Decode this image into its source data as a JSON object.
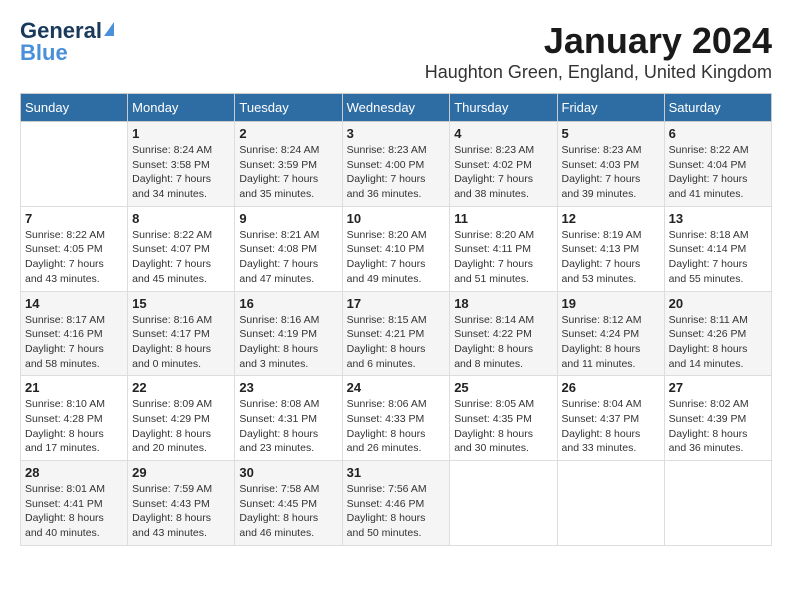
{
  "logo": {
    "general": "General",
    "blue": "Blue"
  },
  "title": "January 2024",
  "location": "Haughton Green, England, United Kingdom",
  "days_of_week": [
    "Sunday",
    "Monday",
    "Tuesday",
    "Wednesday",
    "Thursday",
    "Friday",
    "Saturday"
  ],
  "weeks": [
    [
      {
        "day": "",
        "info": ""
      },
      {
        "day": "1",
        "info": "Sunrise: 8:24 AM\nSunset: 3:58 PM\nDaylight: 7 hours\nand 34 minutes."
      },
      {
        "day": "2",
        "info": "Sunrise: 8:24 AM\nSunset: 3:59 PM\nDaylight: 7 hours\nand 35 minutes."
      },
      {
        "day": "3",
        "info": "Sunrise: 8:23 AM\nSunset: 4:00 PM\nDaylight: 7 hours\nand 36 minutes."
      },
      {
        "day": "4",
        "info": "Sunrise: 8:23 AM\nSunset: 4:02 PM\nDaylight: 7 hours\nand 38 minutes."
      },
      {
        "day": "5",
        "info": "Sunrise: 8:23 AM\nSunset: 4:03 PM\nDaylight: 7 hours\nand 39 minutes."
      },
      {
        "day": "6",
        "info": "Sunrise: 8:22 AM\nSunset: 4:04 PM\nDaylight: 7 hours\nand 41 minutes."
      }
    ],
    [
      {
        "day": "7",
        "info": "Sunrise: 8:22 AM\nSunset: 4:05 PM\nDaylight: 7 hours\nand 43 minutes."
      },
      {
        "day": "8",
        "info": "Sunrise: 8:22 AM\nSunset: 4:07 PM\nDaylight: 7 hours\nand 45 minutes."
      },
      {
        "day": "9",
        "info": "Sunrise: 8:21 AM\nSunset: 4:08 PM\nDaylight: 7 hours\nand 47 minutes."
      },
      {
        "day": "10",
        "info": "Sunrise: 8:20 AM\nSunset: 4:10 PM\nDaylight: 7 hours\nand 49 minutes."
      },
      {
        "day": "11",
        "info": "Sunrise: 8:20 AM\nSunset: 4:11 PM\nDaylight: 7 hours\nand 51 minutes."
      },
      {
        "day": "12",
        "info": "Sunrise: 8:19 AM\nSunset: 4:13 PM\nDaylight: 7 hours\nand 53 minutes."
      },
      {
        "day": "13",
        "info": "Sunrise: 8:18 AM\nSunset: 4:14 PM\nDaylight: 7 hours\nand 55 minutes."
      }
    ],
    [
      {
        "day": "14",
        "info": "Sunrise: 8:17 AM\nSunset: 4:16 PM\nDaylight: 7 hours\nand 58 minutes."
      },
      {
        "day": "15",
        "info": "Sunrise: 8:16 AM\nSunset: 4:17 PM\nDaylight: 8 hours\nand 0 minutes."
      },
      {
        "day": "16",
        "info": "Sunrise: 8:16 AM\nSunset: 4:19 PM\nDaylight: 8 hours\nand 3 minutes."
      },
      {
        "day": "17",
        "info": "Sunrise: 8:15 AM\nSunset: 4:21 PM\nDaylight: 8 hours\nand 6 minutes."
      },
      {
        "day": "18",
        "info": "Sunrise: 8:14 AM\nSunset: 4:22 PM\nDaylight: 8 hours\nand 8 minutes."
      },
      {
        "day": "19",
        "info": "Sunrise: 8:12 AM\nSunset: 4:24 PM\nDaylight: 8 hours\nand 11 minutes."
      },
      {
        "day": "20",
        "info": "Sunrise: 8:11 AM\nSunset: 4:26 PM\nDaylight: 8 hours\nand 14 minutes."
      }
    ],
    [
      {
        "day": "21",
        "info": "Sunrise: 8:10 AM\nSunset: 4:28 PM\nDaylight: 8 hours\nand 17 minutes."
      },
      {
        "day": "22",
        "info": "Sunrise: 8:09 AM\nSunset: 4:29 PM\nDaylight: 8 hours\nand 20 minutes."
      },
      {
        "day": "23",
        "info": "Sunrise: 8:08 AM\nSunset: 4:31 PM\nDaylight: 8 hours\nand 23 minutes."
      },
      {
        "day": "24",
        "info": "Sunrise: 8:06 AM\nSunset: 4:33 PM\nDaylight: 8 hours\nand 26 minutes."
      },
      {
        "day": "25",
        "info": "Sunrise: 8:05 AM\nSunset: 4:35 PM\nDaylight: 8 hours\nand 30 minutes."
      },
      {
        "day": "26",
        "info": "Sunrise: 8:04 AM\nSunset: 4:37 PM\nDaylight: 8 hours\nand 33 minutes."
      },
      {
        "day": "27",
        "info": "Sunrise: 8:02 AM\nSunset: 4:39 PM\nDaylight: 8 hours\nand 36 minutes."
      }
    ],
    [
      {
        "day": "28",
        "info": "Sunrise: 8:01 AM\nSunset: 4:41 PM\nDaylight: 8 hours\nand 40 minutes."
      },
      {
        "day": "29",
        "info": "Sunrise: 7:59 AM\nSunset: 4:43 PM\nDaylight: 8 hours\nand 43 minutes."
      },
      {
        "day": "30",
        "info": "Sunrise: 7:58 AM\nSunset: 4:45 PM\nDaylight: 8 hours\nand 46 minutes."
      },
      {
        "day": "31",
        "info": "Sunrise: 7:56 AM\nSunset: 4:46 PM\nDaylight: 8 hours\nand 50 minutes."
      },
      {
        "day": "",
        "info": ""
      },
      {
        "day": "",
        "info": ""
      },
      {
        "day": "",
        "info": ""
      }
    ]
  ]
}
